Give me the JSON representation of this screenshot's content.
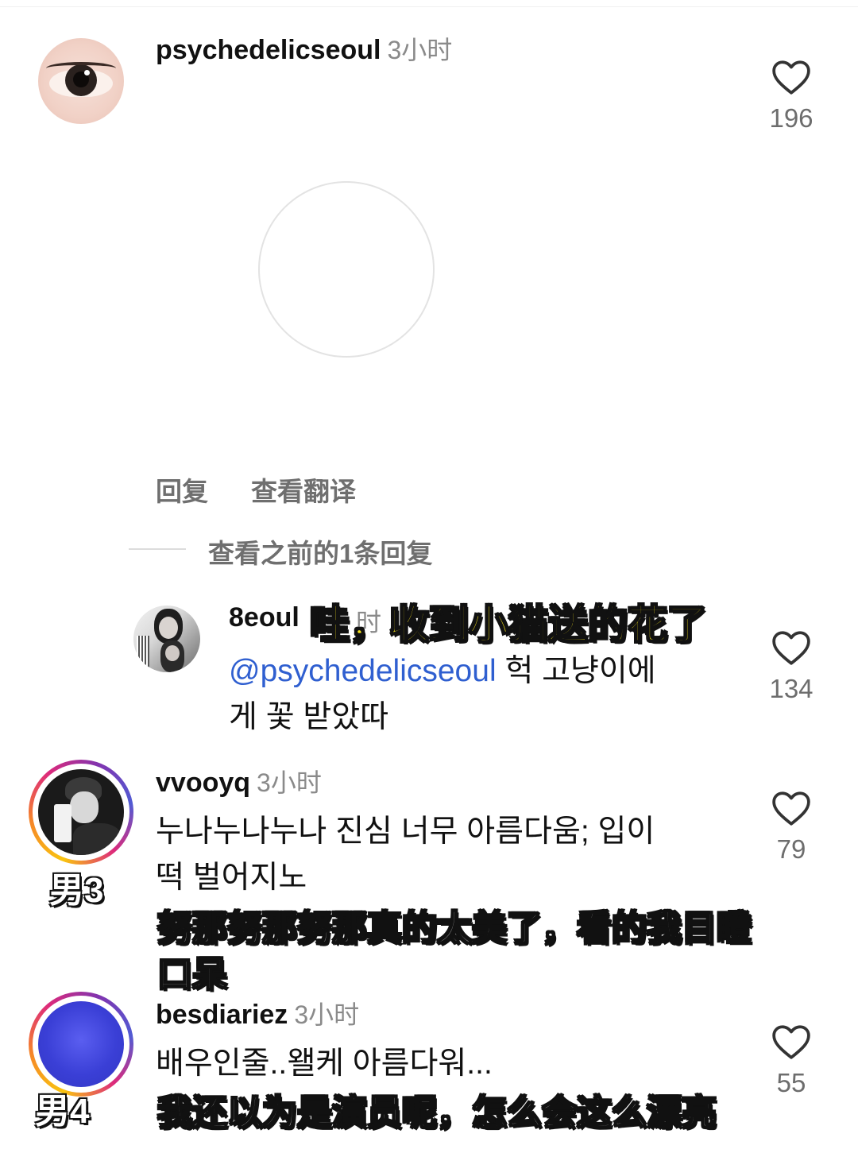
{
  "comments": [
    {
      "username": "psychedelicseoul",
      "time": "3小时",
      "likes": "196",
      "actions": {
        "reply": "回复",
        "translate": "查看翻译"
      },
      "view_previous": "查看之前的1条回复"
    },
    {
      "username": "8eoul",
      "time_fragment": "时",
      "subtitle": "哇，收到小猫送的花了",
      "mention": "@psychedelicseoul",
      "text_line1": " 헉 고냥이에",
      "text_line2": "게 꽃 받았따",
      "likes": "134"
    },
    {
      "username": "vvooyq",
      "time": "3小时",
      "text_line1": "누나누나누나 진심 너무 아름다움; 입이",
      "text_line2": "떡 벌어지노",
      "subtitle_line1": "努那努那努那真的太美了，看的我目瞪",
      "subtitle_line2": "口呆",
      "tag": "男3",
      "likes": "79"
    },
    {
      "username": "besdiariez",
      "time": "3小时",
      "text_line1": "배우인줄..왤케 아름다워...",
      "subtitle": "我还以为是演员呢，怎么会这么漂亮",
      "tag": "男4",
      "likes": "55"
    }
  ],
  "colors": {
    "mention": "#2f5fd0",
    "subtitle_yellow": "#f7e41c",
    "avatar_blue": "#3a3fd6"
  },
  "icons": [
    "heart-icon",
    "mention-icon"
  ]
}
